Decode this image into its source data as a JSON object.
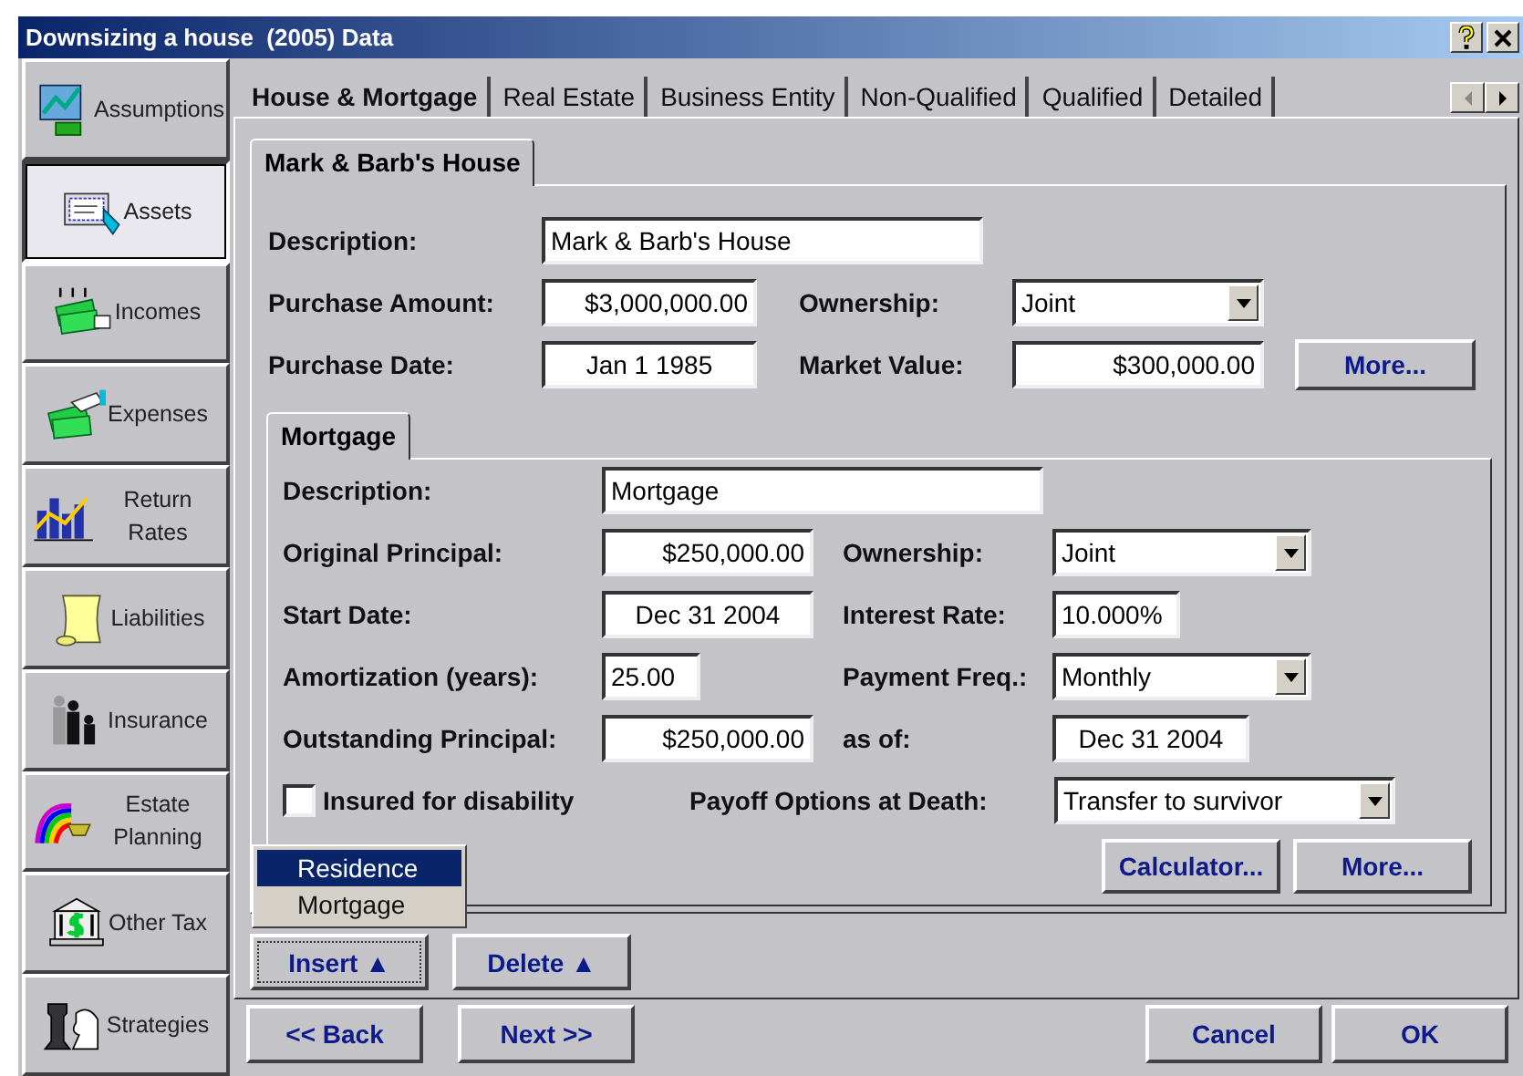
{
  "window": {
    "title": "Downsizing a house  (2005) Data"
  },
  "sidebar": {
    "items": [
      {
        "label": "Assumptions",
        "selected": false
      },
      {
        "label": "Assets",
        "selected": true
      },
      {
        "label": "Incomes",
        "selected": false
      },
      {
        "label": "Expenses",
        "selected": false
      },
      {
        "label": "Return Rates",
        "selected": false
      },
      {
        "label": "Liabilities",
        "selected": false
      },
      {
        "label": "Insurance",
        "selected": false
      },
      {
        "label": "Estate Planning",
        "selected": false
      },
      {
        "label": "Other Tax",
        "selected": false
      },
      {
        "label": "Strategies",
        "selected": false
      }
    ]
  },
  "tabs": [
    {
      "label": "House & Mortgage",
      "selected": true
    },
    {
      "label": "Real Estate",
      "selected": false
    },
    {
      "label": "Business Entity",
      "selected": false
    },
    {
      "label": "Non-Qualified",
      "selected": false
    },
    {
      "label": "Qualified",
      "selected": false
    },
    {
      "label": "Detailed",
      "selected": false
    }
  ],
  "house": {
    "tab": "Mark & Barb's House",
    "rows": [
      [
        {
          "kind": "text",
          "label": "Description:",
          "value": "Mark & Barb's House"
        }
      ],
      [
        {
          "kind": "money",
          "label": "Purchase Amount:",
          "value": "$3,000,000.00"
        },
        {
          "kind": "dropdown",
          "label": "Ownership:",
          "value": "Joint"
        }
      ],
      [
        {
          "kind": "date",
          "label": "Purchase Date:",
          "value": "Jan 1 1985"
        },
        {
          "kind": "money",
          "label": "Market Value:",
          "value": "$300,000.00"
        },
        {
          "kind": "button",
          "label": "More..."
        }
      ]
    ]
  },
  "mortgage": {
    "tab": "Mortgage",
    "rows": [
      [
        {
          "kind": "text",
          "label": "Description:",
          "value": "Mortgage"
        }
      ],
      [
        {
          "kind": "money",
          "label": "Original Principal:",
          "value": "$250,000.00"
        },
        {
          "kind": "dropdown",
          "label": "Ownership:",
          "value": "Joint"
        }
      ],
      [
        {
          "kind": "date",
          "label": "Start Date:",
          "value": "Dec 31 2004"
        },
        {
          "kind": "text",
          "label": "Interest Rate:",
          "value": "10.000%"
        }
      ],
      [
        {
          "kind": "text",
          "label": "Amortization (years):",
          "value": "25.00"
        },
        {
          "kind": "dropdown",
          "label": "Payment Freq.:",
          "value": "Monthly"
        }
      ],
      [
        {
          "kind": "money",
          "label": "Outstanding Principal:",
          "value": "$250,000.00"
        },
        {
          "kind": "date",
          "label": "as of:",
          "value": "Dec 31 2004"
        }
      ],
      [
        {
          "kind": "checkbox",
          "label": "Insured for disability",
          "checked": false
        },
        {
          "kind": "dropdown",
          "label": "Payoff Options at Death:",
          "value": "Transfer to survivor"
        }
      ],
      [
        {
          "kind": "button",
          "label": "Calculator..."
        },
        {
          "kind": "button",
          "label": "More..."
        }
      ]
    ]
  },
  "insert_menu": {
    "items": [
      {
        "label": "Residence",
        "selected": true
      },
      {
        "label": "Mortgage",
        "selected": false
      }
    ]
  },
  "edit_buttons": [
    "Insert ▲",
    "Delete ▲"
  ],
  "nav_buttons": {
    "left": [
      "<< Back",
      "Next >>"
    ],
    "right": [
      "Cancel",
      "OK"
    ]
  }
}
